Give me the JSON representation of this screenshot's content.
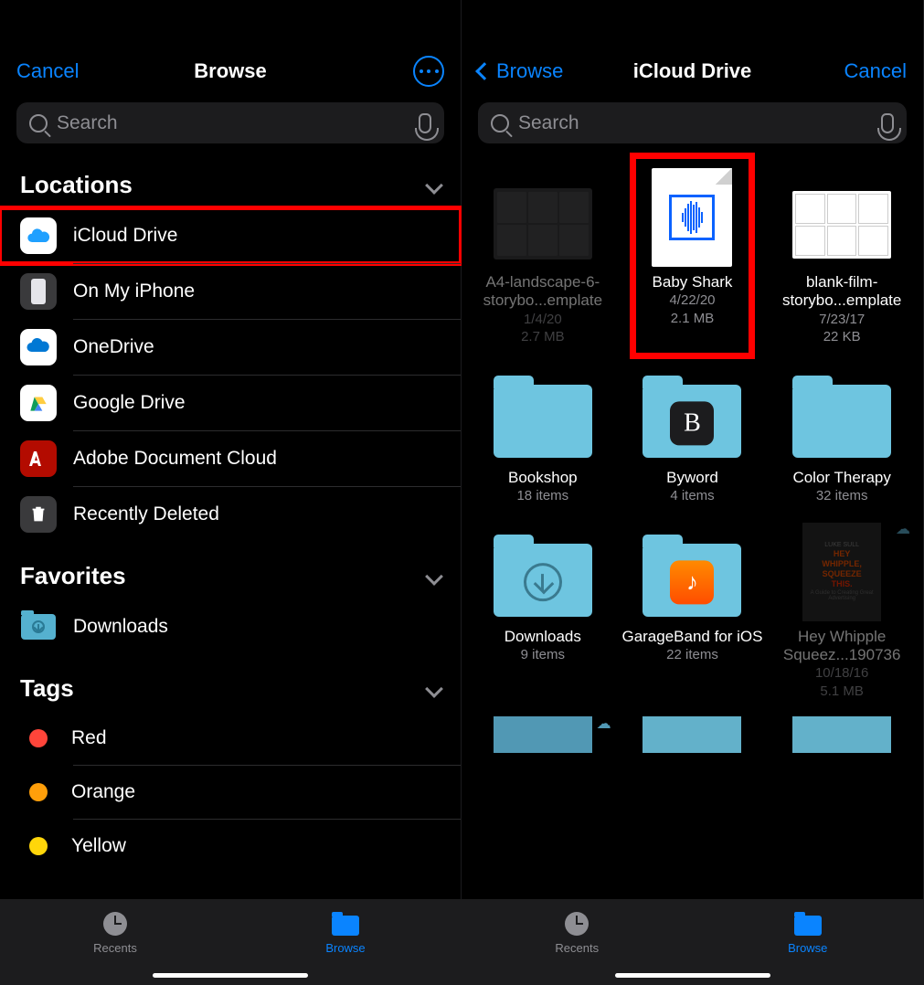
{
  "left": {
    "nav": {
      "cancel": "Cancel",
      "title": "Browse"
    },
    "search_placeholder": "Search",
    "locations_header": "Locations",
    "locations": [
      {
        "label": "iCloud Drive"
      },
      {
        "label": "On My iPhone"
      },
      {
        "label": "OneDrive"
      },
      {
        "label": "Google Drive"
      },
      {
        "label": "Adobe Document Cloud"
      },
      {
        "label": "Recently Deleted"
      }
    ],
    "favorites_header": "Favorites",
    "favorites": [
      {
        "label": "Downloads"
      }
    ],
    "tags_header": "Tags",
    "tags": [
      {
        "label": "Red",
        "color": "#ff453a"
      },
      {
        "label": "Orange",
        "color": "#ff9f0a"
      },
      {
        "label": "Yellow",
        "color": "#ffd60a"
      }
    ],
    "tabs": {
      "recents": "Recents",
      "browse": "Browse"
    }
  },
  "right": {
    "nav": {
      "back": "Browse",
      "title": "iCloud Drive",
      "cancel": "Cancel"
    },
    "search_placeholder": "Search",
    "files": [
      {
        "name": "A4-landscape-6-storybo...emplate",
        "date": "1/4/20",
        "meta": "2.7 MB",
        "dim": true
      },
      {
        "name": "Baby Shark",
        "date": "4/22/20",
        "meta": "2.1 MB",
        "highlight": true
      },
      {
        "name": "blank-film-storybo...emplate",
        "date": "7/23/17",
        "meta": "22 KB"
      },
      {
        "name": "Bookshop",
        "meta": "18 items",
        "folder": true
      },
      {
        "name": "Byword",
        "meta": "4 items",
        "folder": true,
        "badge": "B"
      },
      {
        "name": "Color Therapy",
        "meta": "32 items",
        "folder": true
      },
      {
        "name": "Downloads",
        "meta": "9 items",
        "folder": true,
        "dl": true
      },
      {
        "name": "GarageBand for iOS",
        "meta": "22 items",
        "folder": true,
        "gb": true
      },
      {
        "name": "Hey Whipple Squeez...190736",
        "date": "10/18/16",
        "meta": "5.1 MB",
        "dim": true,
        "book": true
      }
    ],
    "tabs": {
      "recents": "Recents",
      "browse": "Browse"
    }
  }
}
